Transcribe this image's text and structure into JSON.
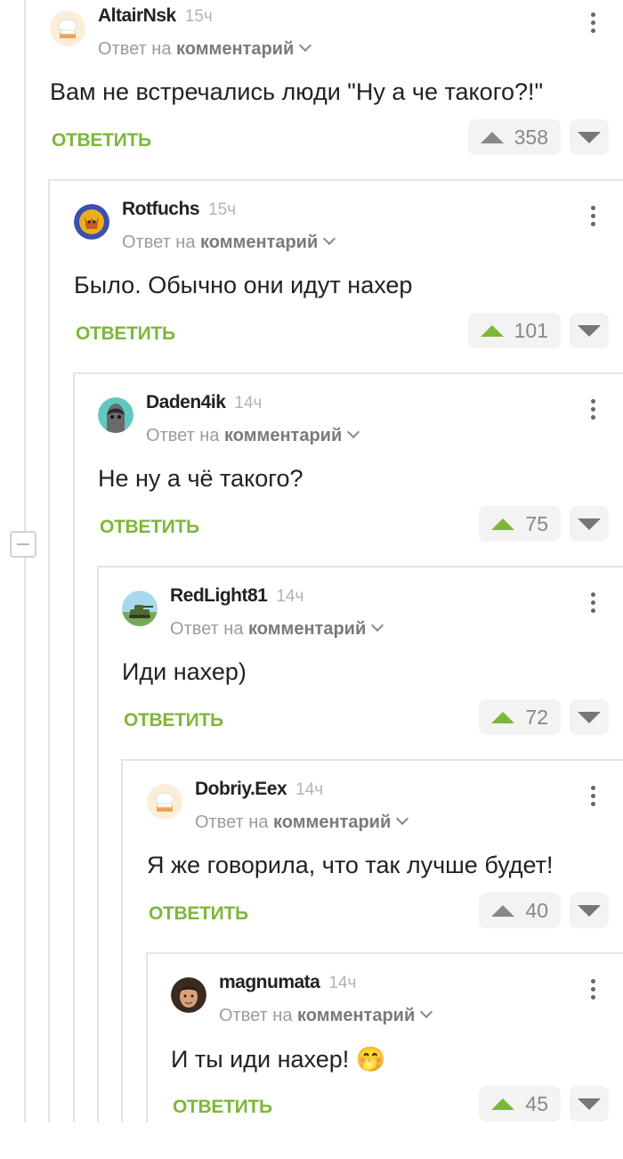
{
  "comments": [
    {
      "username": "AltairNsk",
      "time": "15ч",
      "reply_prefix": "Ответ на",
      "reply_target": "комментарий",
      "text": "Вам не встречались люди \"Ну а че такого?!\"",
      "reply_label": "ОТВЕТИТЬ",
      "votes": "358",
      "upvoted": false
    },
    {
      "username": "Rotfuchs",
      "time": "15ч",
      "reply_prefix": "Ответ на",
      "reply_target": "комментарий",
      "text": "Было. Обычно они идут нахер",
      "reply_label": "ОТВЕТИТЬ",
      "votes": "101",
      "upvoted": true
    },
    {
      "username": "Daden4ik",
      "time": "14ч",
      "reply_prefix": "Ответ на",
      "reply_target": "комментарий",
      "text": "Не ну а чё такого?",
      "reply_label": "ОТВЕТИТЬ",
      "votes": "75",
      "upvoted": true
    },
    {
      "username": "RedLight81",
      "time": "14ч",
      "reply_prefix": "Ответ на",
      "reply_target": "комментарий",
      "text": "Иди нахер)",
      "reply_label": "ОТВЕТИТЬ",
      "votes": "72",
      "upvoted": true
    },
    {
      "username": "Dobriy.Eex",
      "time": "14ч",
      "reply_prefix": "Ответ на",
      "reply_target": "комментарий",
      "text": "Я же говорила, что так лучше будет!",
      "reply_label": "ОТВЕТИТЬ",
      "votes": "40",
      "upvoted": false
    },
    {
      "username": "magnumata",
      "time": "14ч",
      "reply_prefix": "Ответ на",
      "reply_target": "комментарий",
      "text": "И ты иди нахер! 🤭",
      "reply_label": "ОТВЕТИТЬ",
      "votes": "45",
      "upvoted": true
    }
  ],
  "colors": {
    "accent_green": "#7db73a",
    "vote_gray": "#888888",
    "thread_line": "#e3e3e3"
  },
  "icons": [
    "chef-hat-avatar-icon",
    "fox-avatar-icon",
    "cartoon-face-avatar-icon",
    "tank-avatar-icon",
    "chef-hat-avatar-icon",
    "person-photo-avatar-icon",
    "more-vertical-icon",
    "chevron-down-icon",
    "vote-up-icon",
    "vote-down-icon",
    "collapse-thread-icon"
  ]
}
